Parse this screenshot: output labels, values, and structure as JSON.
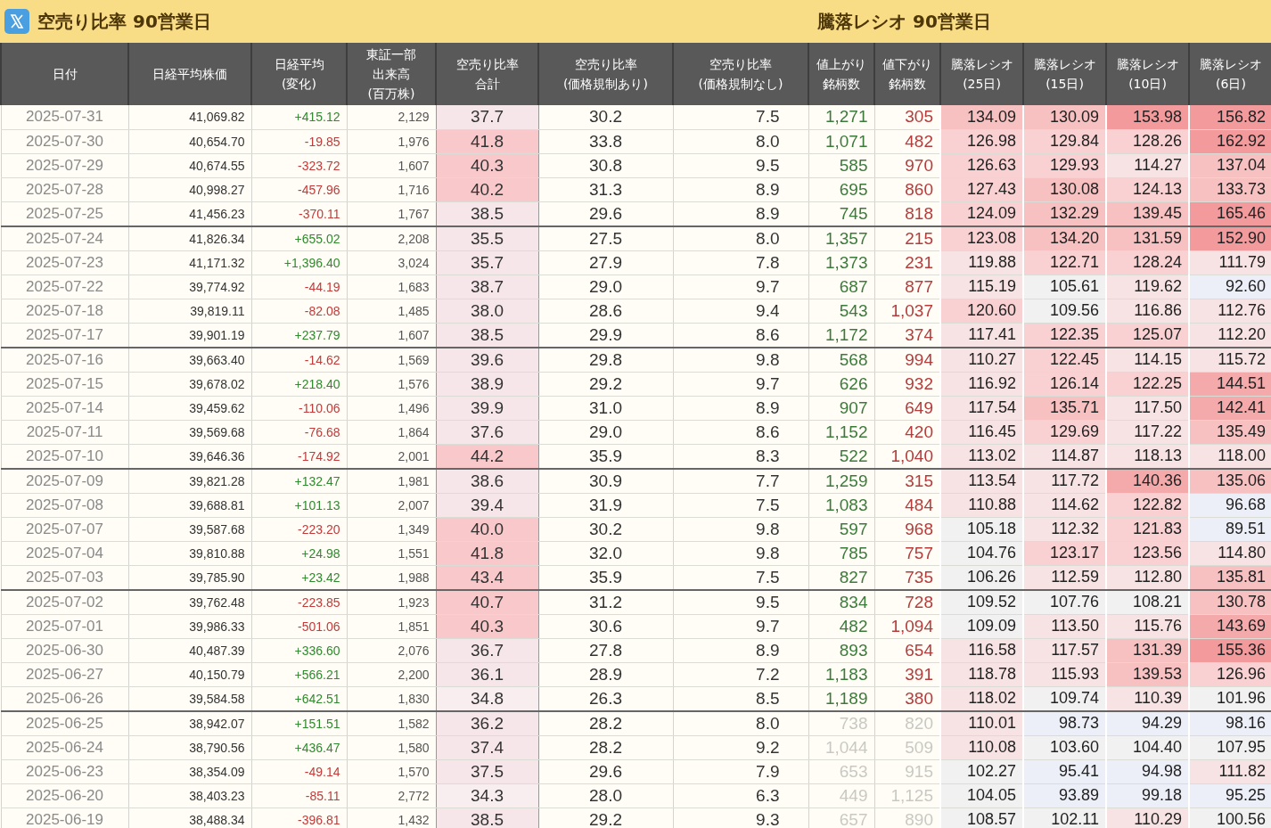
{
  "titles": [
    {
      "text": "空売り比率 90営業日",
      "logo": true
    },
    {
      "text": "騰落レシオ 90営業日",
      "logo": false
    }
  ],
  "table": {
    "columns": [
      {
        "kind": "date",
        "lines": [
          "日付"
        ]
      },
      {
        "kind": "price",
        "lines": [
          "日経平均株価"
        ]
      },
      {
        "kind": "change",
        "lines": [
          "日経平均",
          "(変化)"
        ]
      },
      {
        "kind": "volume",
        "lines": [
          "東証一部",
          "出来高",
          "(百万株)"
        ]
      },
      {
        "kind": "short",
        "lines": [
          "空売り比率",
          "合計"
        ]
      },
      {
        "kind": "sub",
        "lines": [
          "空売り比率",
          "(価格規制あり)"
        ]
      },
      {
        "kind": "subr",
        "lines": [
          "空売り比率",
          "(価格規制なし)"
        ]
      },
      {
        "kind": "adv",
        "lines": [
          "値上がり",
          "銘柄数"
        ]
      },
      {
        "kind": "dec",
        "lines": [
          "値下がり",
          "銘柄数"
        ]
      },
      {
        "kind": "ratio",
        "lines": [
          "騰落レシオ",
          "(25日)"
        ]
      },
      {
        "kind": "ratio",
        "lines": [
          "騰落レシオ",
          "(15日)"
        ]
      },
      {
        "kind": "ratio",
        "lines": [
          "騰落レシオ",
          "(10日)"
        ]
      },
      {
        "kind": "ratio",
        "lines": [
          "騰落レシオ",
          "(6日)"
        ]
      }
    ],
    "rows": [
      {
        "rising": true,
        "faded": false,
        "cells": [
          "2025-07-31",
          "41,069.82",
          "+415.12",
          "2,129",
          "37.7",
          "30.2",
          "7.5",
          "1,271",
          "305",
          "134.09",
          "130.09",
          "153.98",
          "156.82"
        ]
      },
      {
        "rising": false,
        "faded": false,
        "cells": [
          "2025-07-30",
          "40,654.70",
          "-19.85",
          "1,976",
          "41.8",
          "33.8",
          "8.0",
          "1,071",
          "482",
          "126.98",
          "129.84",
          "128.26",
          "162.92"
        ]
      },
      {
        "rising": false,
        "faded": false,
        "cells": [
          "2025-07-29",
          "40,674.55",
          "-323.72",
          "1,607",
          "40.3",
          "30.8",
          "9.5",
          "585",
          "970",
          "126.63",
          "129.93",
          "114.27",
          "137.04"
        ]
      },
      {
        "rising": false,
        "faded": false,
        "cells": [
          "2025-07-28",
          "40,998.27",
          "-457.96",
          "1,716",
          "40.2",
          "31.3",
          "8.9",
          "695",
          "860",
          "127.43",
          "130.08",
          "124.13",
          "133.73"
        ]
      },
      {
        "rising": false,
        "faded": false,
        "cells": [
          "2025-07-25",
          "41,456.23",
          "-370.11",
          "1,767",
          "38.5",
          "29.6",
          "8.9",
          "745",
          "818",
          "124.09",
          "132.29",
          "139.45",
          "165.46"
        ]
      },
      {
        "rising": true,
        "faded": false,
        "cells": [
          "2025-07-24",
          "41,826.34",
          "+655.02",
          "2,208",
          "35.5",
          "27.5",
          "8.0",
          "1,357",
          "215",
          "123.08",
          "134.20",
          "131.59",
          "152.90"
        ]
      },
      {
        "rising": true,
        "faded": false,
        "cells": [
          "2025-07-23",
          "41,171.32",
          "+1,396.40",
          "3,024",
          "35.7",
          "27.9",
          "7.8",
          "1,373",
          "231",
          "119.88",
          "122.71",
          "128.24",
          "111.79"
        ]
      },
      {
        "rising": false,
        "faded": false,
        "cells": [
          "2025-07-22",
          "39,774.92",
          "-44.19",
          "1,683",
          "38.7",
          "29.0",
          "9.7",
          "687",
          "877",
          "115.19",
          "105.61",
          "119.62",
          "92.60"
        ]
      },
      {
        "rising": false,
        "faded": false,
        "cells": [
          "2025-07-18",
          "39,819.11",
          "-82.08",
          "1,485",
          "38.0",
          "28.6",
          "9.4",
          "543",
          "1,037",
          "120.60",
          "109.56",
          "116.86",
          "112.76"
        ]
      },
      {
        "rising": true,
        "faded": false,
        "cells": [
          "2025-07-17",
          "39,901.19",
          "+237.79",
          "1,607",
          "38.5",
          "29.9",
          "8.6",
          "1,172",
          "374",
          "117.41",
          "122.35",
          "125.07",
          "112.20"
        ]
      },
      {
        "rising": false,
        "faded": false,
        "cells": [
          "2025-07-16",
          "39,663.40",
          "-14.62",
          "1,569",
          "39.6",
          "29.8",
          "9.8",
          "568",
          "994",
          "110.27",
          "122.45",
          "114.15",
          "115.72"
        ]
      },
      {
        "rising": true,
        "faded": false,
        "cells": [
          "2025-07-15",
          "39,678.02",
          "+218.40",
          "1,576",
          "38.9",
          "29.2",
          "9.7",
          "626",
          "932",
          "116.92",
          "126.14",
          "122.25",
          "144.51"
        ]
      },
      {
        "rising": false,
        "faded": false,
        "cells": [
          "2025-07-14",
          "39,459.62",
          "-110.06",
          "1,496",
          "39.9",
          "31.0",
          "8.9",
          "907",
          "649",
          "117.54",
          "135.71",
          "117.50",
          "142.41"
        ]
      },
      {
        "rising": false,
        "faded": false,
        "cells": [
          "2025-07-11",
          "39,569.68",
          "-76.68",
          "1,864",
          "37.6",
          "29.0",
          "8.6",
          "1,152",
          "420",
          "116.45",
          "129.69",
          "117.22",
          "135.49"
        ]
      },
      {
        "rising": false,
        "faded": false,
        "cells": [
          "2025-07-10",
          "39,646.36",
          "-174.92",
          "2,001",
          "44.2",
          "35.9",
          "8.3",
          "522",
          "1,040",
          "113.02",
          "114.87",
          "118.13",
          "118.00"
        ]
      },
      {
        "rising": true,
        "faded": false,
        "cells": [
          "2025-07-09",
          "39,821.28",
          "+132.47",
          "1,981",
          "38.6",
          "30.9",
          "7.7",
          "1,259",
          "315",
          "113.54",
          "117.72",
          "140.36",
          "135.06"
        ]
      },
      {
        "rising": true,
        "faded": false,
        "cells": [
          "2025-07-08",
          "39,688.81",
          "+101.13",
          "2,007",
          "39.4",
          "31.9",
          "7.5",
          "1,083",
          "484",
          "110.88",
          "114.62",
          "122.82",
          "96.68"
        ]
      },
      {
        "rising": false,
        "faded": false,
        "cells": [
          "2025-07-07",
          "39,587.68",
          "-223.20",
          "1,349",
          "40.0",
          "30.2",
          "9.8",
          "597",
          "968",
          "105.18",
          "112.32",
          "121.83",
          "89.51"
        ]
      },
      {
        "rising": true,
        "faded": false,
        "cells": [
          "2025-07-04",
          "39,810.88",
          "+24.98",
          "1,551",
          "41.8",
          "32.0",
          "9.8",
          "785",
          "757",
          "104.76",
          "123.17",
          "123.56",
          "114.80"
        ]
      },
      {
        "rising": true,
        "faded": false,
        "cells": [
          "2025-07-03",
          "39,785.90",
          "+23.42",
          "1,988",
          "43.4",
          "35.9",
          "7.5",
          "827",
          "735",
          "106.26",
          "112.59",
          "112.80",
          "135.81"
        ]
      },
      {
        "rising": false,
        "faded": false,
        "cells": [
          "2025-07-02",
          "39,762.48",
          "-223.85",
          "1,923",
          "40.7",
          "31.2",
          "9.5",
          "834",
          "728",
          "109.52",
          "107.76",
          "108.21",
          "130.78"
        ]
      },
      {
        "rising": false,
        "faded": false,
        "cells": [
          "2025-07-01",
          "39,986.33",
          "-501.06",
          "1,851",
          "40.3",
          "30.6",
          "9.7",
          "482",
          "1,094",
          "109.09",
          "113.50",
          "115.76",
          "143.69"
        ]
      },
      {
        "rising": true,
        "faded": false,
        "cells": [
          "2025-06-30",
          "40,487.39",
          "+336.60",
          "2,076",
          "36.7",
          "27.8",
          "8.9",
          "893",
          "654",
          "116.58",
          "117.57",
          "131.39",
          "155.36"
        ]
      },
      {
        "rising": true,
        "faded": false,
        "cells": [
          "2025-06-27",
          "40,150.79",
          "+566.21",
          "2,200",
          "36.1",
          "28.9",
          "7.2",
          "1,183",
          "391",
          "118.78",
          "115.93",
          "139.53",
          "126.96"
        ]
      },
      {
        "rising": true,
        "faded": false,
        "cells": [
          "2025-06-26",
          "39,584.58",
          "+642.51",
          "1,830",
          "34.8",
          "26.3",
          "8.5",
          "1,189",
          "380",
          "118.02",
          "109.74",
          "110.39",
          "101.96"
        ]
      },
      {
        "rising": true,
        "faded": true,
        "cells": [
          "2025-06-25",
          "38,942.07",
          "+151.51",
          "1,582",
          "36.2",
          "28.2",
          "8.0",
          "738",
          "820",
          "110.01",
          "98.73",
          "94.29",
          "98.16"
        ]
      },
      {
        "rising": true,
        "faded": true,
        "cells": [
          "2025-06-24",
          "38,790.56",
          "+436.47",
          "1,580",
          "37.4",
          "28.2",
          "9.2",
          "1,044",
          "509",
          "110.08",
          "103.60",
          "104.40",
          "107.95"
        ]
      },
      {
        "rising": false,
        "faded": true,
        "cells": [
          "2025-06-23",
          "38,354.09",
          "-49.14",
          "1,570",
          "37.5",
          "29.6",
          "7.9",
          "653",
          "915",
          "102.27",
          "95.41",
          "94.98",
          "111.82"
        ]
      },
      {
        "rising": false,
        "faded": true,
        "cells": [
          "2025-06-20",
          "38,403.23",
          "-85.11",
          "2,772",
          "34.3",
          "28.0",
          "6.3",
          "449",
          "1,125",
          "104.05",
          "93.89",
          "99.18",
          "95.25"
        ]
      },
      {
        "rising": false,
        "faded": true,
        "cells": [
          "2025-06-19",
          "38,488.34",
          "-396.81",
          "1,432",
          "38.5",
          "29.2",
          "9.3",
          "657",
          "890",
          "108.57",
          "102.11",
          "110.29",
          "100.56"
        ]
      }
    ]
  }
}
